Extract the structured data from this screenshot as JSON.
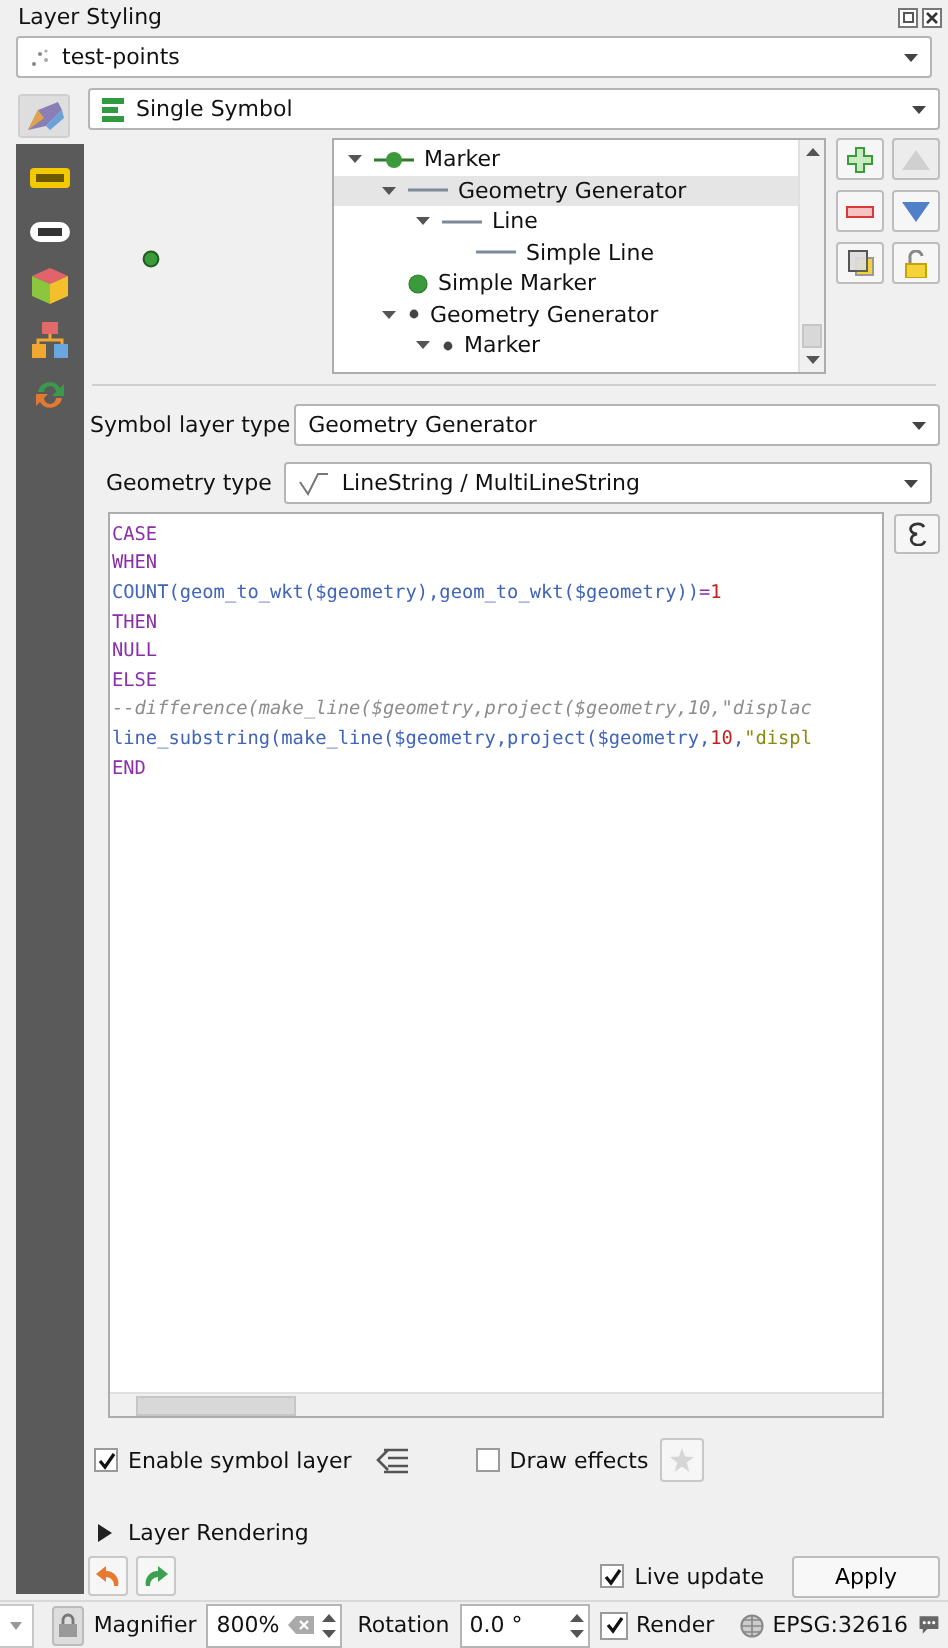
{
  "window": {
    "title": "Layer Styling"
  },
  "layer_combo": {
    "value": "test-points"
  },
  "renderer_combo": {
    "value": "Single Symbol"
  },
  "side_tabs": [
    {
      "kind": "symbology",
      "selected": true
    },
    {
      "kind": "labels",
      "selected": false
    },
    {
      "kind": "masks",
      "selected": false
    },
    {
      "kind": "cube",
      "selected": false
    },
    {
      "kind": "diagrams",
      "selected": false
    },
    {
      "kind": "history",
      "selected": false
    }
  ],
  "symbol_tree": [
    {
      "label": "Marker",
      "kind": "marker",
      "expanded": true,
      "selected": false,
      "children": [
        {
          "label": "Geometry Generator",
          "kind": "line",
          "expanded": true,
          "selected": true,
          "children": [
            {
              "label": "Line",
              "kind": "line",
              "expanded": true,
              "selected": false,
              "children": [
                {
                  "label": "Simple Line",
                  "kind": "line",
                  "selected": false
                }
              ]
            }
          ]
        },
        {
          "label": "Simple Marker",
          "kind": "dot",
          "selected": false
        },
        {
          "label": "Geometry Generator",
          "kind": "small-dot",
          "expanded": true,
          "selected": false,
          "children": [
            {
              "label": "Marker",
              "kind": "small-dot",
              "expanded": true,
              "selected": false
            }
          ]
        }
      ]
    }
  ],
  "symbol_layer_type": {
    "label": "Symbol layer type",
    "value": "Geometry Generator"
  },
  "geometry_type": {
    "label": "Geometry type",
    "value": "LineString / MultiLineString"
  },
  "expression": [
    [
      {
        "kind": "keyword",
        "text": "CASE"
      }
    ],
    [
      {
        "kind": "keyword",
        "text": "WHEN"
      }
    ],
    [
      {
        "kind": "func",
        "text": "COUNT(geom_to_wkt($geometry),geom_to_wkt($geometry))"
      },
      {
        "kind": "operator",
        "text": "="
      },
      {
        "kind": "number",
        "text": "1"
      }
    ],
    [
      {
        "kind": "keyword",
        "text": "THEN"
      }
    ],
    [
      {
        "kind": "keyword",
        "text": "NULL"
      }
    ],
    [
      {
        "kind": "keyword",
        "text": "ELSE"
      }
    ],
    [
      {
        "kind": "comment",
        "text": "--difference(make_line($geometry,project($geometry,10,\"displac"
      }
    ],
    [
      {
        "kind": "func",
        "text": "line_substring(make_line($geometry,project($geometry,"
      },
      {
        "kind": "number",
        "text": "10"
      },
      {
        "kind": "func",
        "text": ","
      },
      {
        "kind": "string",
        "text": "\"displ"
      }
    ],
    [
      {
        "kind": "keyword",
        "text": "END"
      }
    ]
  ],
  "enable_symbol_layer": {
    "label": "Enable symbol layer",
    "checked": true
  },
  "draw_effects": {
    "label": "Draw effects",
    "checked": false
  },
  "layer_rendering": {
    "label": "Layer Rendering",
    "expanded": false
  },
  "live_update": {
    "label": "Live update",
    "checked": true
  },
  "apply_button": "Apply",
  "status_bar": {
    "magnifier_label": "Magnifier",
    "magnifier": "800%",
    "rotation_label": "Rotation",
    "rotation": "0.0 °",
    "render": {
      "label": "Render",
      "checked": true
    },
    "crs": "EPSG:32616"
  }
}
